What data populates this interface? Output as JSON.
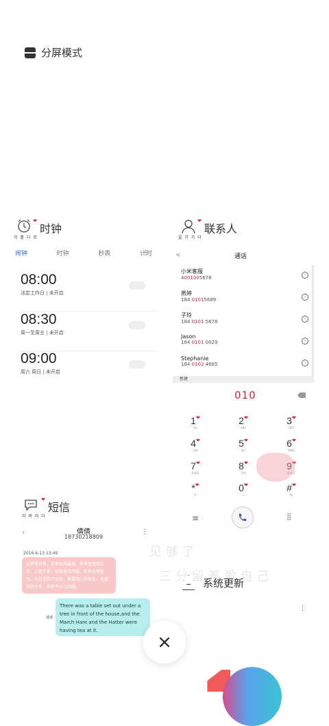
{
  "split_mode": {
    "label": "分屏模式",
    "icon": "split-screen-icon"
  },
  "clock": {
    "app_name": "时钟",
    "icon_caption": "자 홀 다 로",
    "tabs": [
      "闹钟",
      "时钟",
      "秒表",
      "计时"
    ],
    "active_tab": "闹钟",
    "alarms": [
      {
        "time": "08:00",
        "desc": "法定工作日 | 未开启",
        "enabled": false
      },
      {
        "time": "08:30",
        "desc": "周一至周五 | 未开启",
        "enabled": false
      },
      {
        "time": "09:00",
        "desc": "周六 周日 | 未开启",
        "enabled": false
      }
    ]
  },
  "contacts": {
    "app_name": "联系人",
    "icon_caption": "을 가 가 다",
    "title": "通话",
    "back": "<",
    "list": [
      {
        "name": "小米客服",
        "phone_pre": "4",
        "phone_hl": "0010",
        "phone_post": "05678"
      },
      {
        "name": "燕婷",
        "phone_pre": "184 ",
        "phone_hl": "0101",
        "phone_post": "5689"
      },
      {
        "name": "子玲",
        "phone_pre": "184 ",
        "phone_hl": "0101",
        "phone_post": " 5678"
      },
      {
        "name": "Jason",
        "phone_pre": "184 ",
        "phone_hl": "0101",
        "phone_post": " 0029"
      },
      {
        "name": "Stephanie",
        "phone_pre": "184 ",
        "phone_hl": "0102",
        "phone_post": " 4685"
      }
    ],
    "band_text": "新建"
  },
  "dialpad": {
    "number": "010",
    "keys": [
      {
        "d": "1",
        "l": "GU"
      },
      {
        "d": "2",
        "l": "ABC"
      },
      {
        "d": "3",
        "l": "DEF"
      },
      {
        "d": "4",
        "l": "GHI"
      },
      {
        "d": "5",
        "l": "JKL"
      },
      {
        "d": "6",
        "l": "MNO"
      },
      {
        "d": "7",
        "l": "PQRS"
      },
      {
        "d": "8",
        "l": "TUV"
      },
      {
        "d": "9",
        "l": "WXYZ"
      },
      {
        "d": "*",
        "l": "P"
      },
      {
        "d": "0",
        "l": "+"
      },
      {
        "d": "#",
        "l": "W"
      }
    ]
  },
  "sms": {
    "app_name": "短信",
    "icon_caption": "자 바 라 다",
    "contact_name": "倩倩",
    "contact_number": "18730218809",
    "date": "2016-6-13 13:49",
    "incoming": "以梦看世界，却使站的最美，世界还是那么会，心看世界，却使身位而事，世界在界驶大。走过走的不远来，需要用心去体会，无爱得欢大多，若将平小心回避。",
    "outgoing": "There was a table set out under a tree in front of the house,and the March Hare and the Hatter were having tea at it.",
    "sender_label": "话话"
  },
  "update": {
    "app_name": "系统更新"
  },
  "close": {
    "glyph": "×"
  },
  "decor": {
    "watermark1": "见 够 了",
    "watermark2": "三 分 留 着 爱 自 己"
  }
}
